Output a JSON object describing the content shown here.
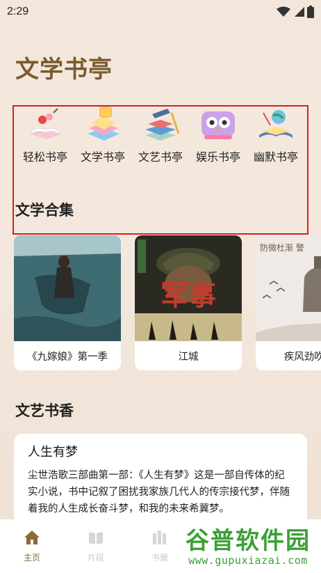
{
  "status": {
    "time": "2:29"
  },
  "app": {
    "title": "文学书亭"
  },
  "categories": [
    {
      "label": "轻松书亭",
      "icon": "books-with-apple-icon"
    },
    {
      "label": "文学书亭",
      "icon": "stacked-books-icon"
    },
    {
      "label": "文艺书亭",
      "icon": "books-with-pencil-icon"
    },
    {
      "label": "娱乐书亭",
      "icon": "owl-book-icon"
    },
    {
      "label": "幽默书亭",
      "icon": "books-with-globe-icon"
    }
  ],
  "sections": {
    "collection": {
      "title": "文学合集"
    },
    "fragrance": {
      "title": "文艺书香"
    }
  },
  "books": [
    {
      "name": "《九嫁娘》第一季"
    },
    {
      "name": "江城",
      "cover_text": "军事"
    },
    {
      "name": "疾风劲吹了",
      "cover_text": "防微杜渐 警"
    }
  ],
  "article": {
    "title": "人生有梦",
    "body": "尘世浩歌三部曲第一部：《人生有梦》这是一部自传体的纪实小说，书中记叙了困扰我家族几代人的传宗接代梦，伴随着我的人生成长奋斗梦，和我的未来希冀梦。"
  },
  "nav": [
    {
      "label": "主页",
      "icon": "home-icon",
      "active": true
    },
    {
      "label": "片段",
      "icon": "book-icon",
      "active": false
    },
    {
      "label": "书屋",
      "icon": "library-icon",
      "active": false
    }
  ],
  "watermark": {
    "logo": "谷普软件园",
    "url": "www.gupuxiazai.com"
  },
  "colors": {
    "title": "#7a5a2e",
    "highlight": "#d32020",
    "nav_active": "#8a6a3a",
    "watermark": "#3aa135"
  }
}
